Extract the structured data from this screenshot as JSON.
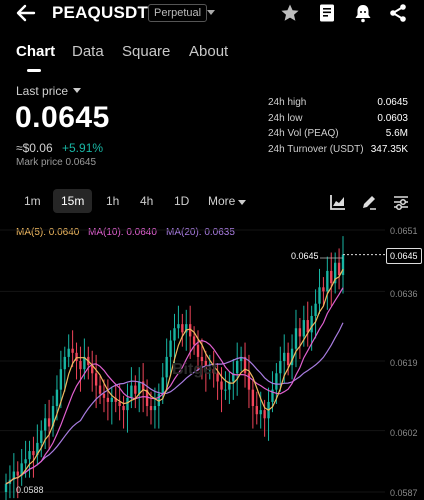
{
  "header": {
    "symbol": "PEAQUSDT",
    "contract_type": "Perpetual",
    "icons": [
      "back-arrow-icon",
      "chevron-down-icon",
      "star-icon",
      "notebook-icon",
      "alarm-bell-icon",
      "share-icon"
    ]
  },
  "tabs": [
    {
      "label": "Chart",
      "active": true
    },
    {
      "label": "Data",
      "active": false
    },
    {
      "label": "Square",
      "active": false
    },
    {
      "label": "About",
      "active": false
    }
  ],
  "price_block": {
    "label": "Last price",
    "last_price": "0.0645",
    "fiat": "≈$0.06",
    "change": "+5.91%",
    "mark_price": "Mark price  0.0645"
  },
  "stats": [
    {
      "label": "24h high",
      "value": "0.0645"
    },
    {
      "label": "24h low",
      "value": "0.0603"
    },
    {
      "label": "24h Vol (PEAQ)",
      "value": "5.6M"
    },
    {
      "label": "24h Turnover (USDT)",
      "value": "347.35K"
    }
  ],
  "intervals": [
    "1m",
    "15m",
    "1h",
    "4h",
    "1D",
    "More"
  ],
  "active_interval": "15m",
  "toolbar_icons": [
    "indicator-icon",
    "draw-pen-icon",
    "settings-sliders-icon"
  ],
  "ma_labels": [
    {
      "text": "MA(5): 0.0640",
      "color": "#f0b960"
    },
    {
      "text": "MA(10): 0.0640",
      "color": "#e060d0"
    },
    {
      "text": "MA(20): 0.0635",
      "color": "#a87ce0"
    }
  ],
  "colors": {
    "up": "#18b6a4",
    "down": "#f0455a",
    "ma5": "#f0b960",
    "ma10": "#e060d0",
    "ma20": "#a87ce0"
  },
  "chart_data": {
    "type": "candlestick",
    "y_ticks": [
      "0.0651",
      "0.0636",
      "0.0619",
      "0.0602",
      "0.0587"
    ],
    "ylim": [
      0.0587,
      0.0651
    ],
    "current_price_tag": "0.0645",
    "high_marker": "0.0645",
    "low_marker": "0.0588",
    "watermark": "Bitget",
    "close": [
      0.0589,
      0.059,
      0.0592,
      0.0591,
      0.0594,
      0.0595,
      0.0597,
      0.0596,
      0.0599,
      0.0602,
      0.0605,
      0.0603,
      0.0608,
      0.0612,
      0.0617,
      0.062,
      0.0622,
      0.0621,
      0.0619,
      0.0617,
      0.062,
      0.0618,
      0.0616,
      0.0613,
      0.0611,
      0.061,
      0.0609,
      0.061,
      0.0609,
      0.0608,
      0.0607,
      0.061,
      0.0613,
      0.0611,
      0.0614,
      0.0612,
      0.0608,
      0.0607,
      0.0608,
      0.0611,
      0.0615,
      0.062,
      0.0624,
      0.0627,
      0.0628,
      0.0626,
      0.0628,
      0.0625,
      0.0623,
      0.062,
      0.0619,
      0.0617,
      0.0617,
      0.0616,
      0.0614,
      0.0612,
      0.0612,
      0.0614,
      0.0616,
      0.0619,
      0.062,
      0.0616,
      0.0612,
      0.0608,
      0.0606,
      0.0607,
      0.0605,
      0.0609,
      0.0612,
      0.0616,
      0.0619,
      0.0621,
      0.0618,
      0.0622,
      0.0627,
      0.0625,
      0.0629,
      0.0626,
      0.063,
      0.0633,
      0.0637,
      0.0636,
      0.0641,
      0.0638,
      0.0643,
      0.064,
      0.0645
    ]
  }
}
